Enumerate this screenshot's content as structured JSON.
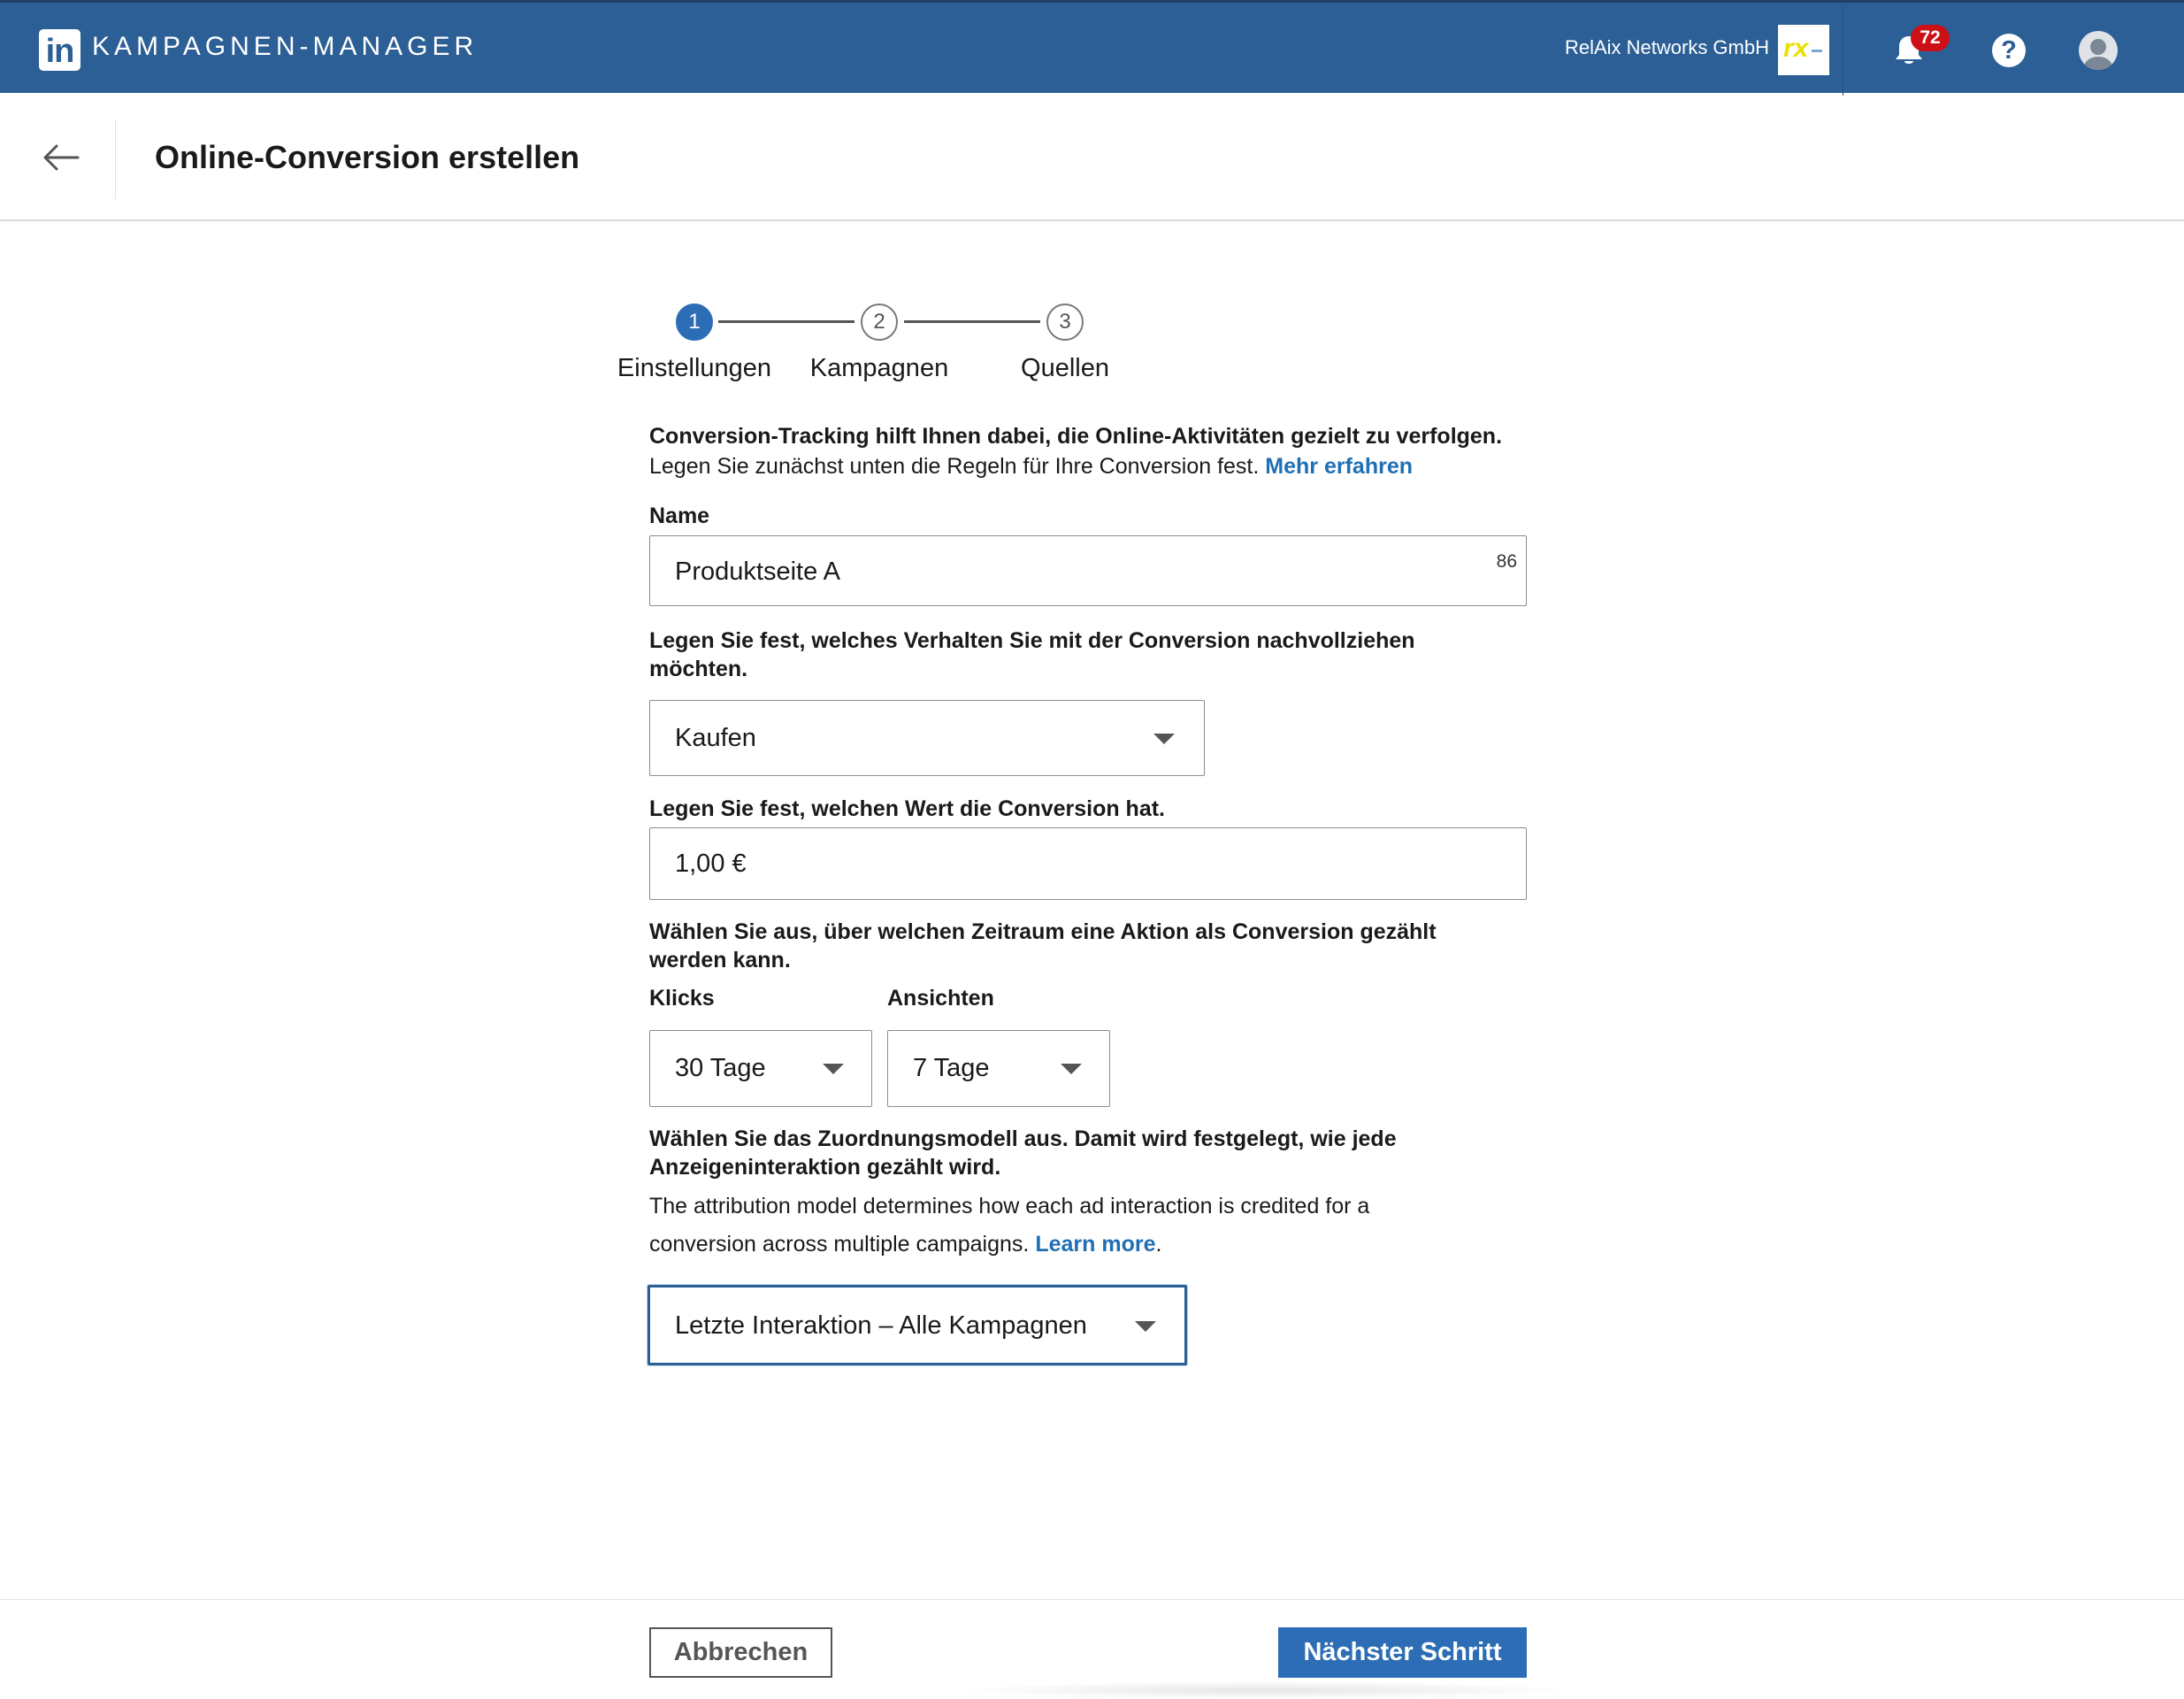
{
  "topbar": {
    "logo_text": "in",
    "app_title": "KAMPAGNEN-MANAGER",
    "company_name": "RelAix Networks GmbH",
    "company_logo_text": "rx",
    "notification_count": "72",
    "help_glyph": "?",
    "bg_color": "#2c5f96"
  },
  "header": {
    "title": "Online-Conversion erstellen"
  },
  "stepper": {
    "steps": [
      {
        "number": "1",
        "label": "Einstellungen",
        "state": "active"
      },
      {
        "number": "2",
        "label": "Kampagnen",
        "state": "todo"
      },
      {
        "number": "3",
        "label": "Quellen",
        "state": "todo"
      }
    ]
  },
  "intro": {
    "bold_line": "Conversion-Tracking hilft Ihnen dabei, die Online-Aktivitäten gezielt zu verfolgen.",
    "line": "Legen Sie zunächst unten die Regeln für Ihre Conversion fest.",
    "link": "Mehr erfahren"
  },
  "form": {
    "name_label": "Name",
    "name_value": "Produktseite A",
    "name_counter": "86",
    "behavior_label": "Legen Sie fest, welches Verhalten Sie mit der Conversion nachvollziehen möchten.",
    "behavior_value": "Kaufen",
    "value_label": "Legen Sie fest, welchen Wert die Conversion hat.",
    "value_value": "1,00 €",
    "window_label": "Wählen Sie aus, über welchen Zeitraum eine Aktion als Conversion gezählt werden kann.",
    "clicks_label": "Klicks",
    "clicks_value": "30 Tage",
    "views_label": "Ansichten",
    "views_value": "7 Tage",
    "attribution_label": "Wählen Sie das Zuordnungsmodell aus. Damit wird festgelegt, wie jede Anzeigeninteraktion gezählt wird.",
    "attribution_help": "The attribution model determines how each ad interaction is credited for a conversion across multiple campaigns.",
    "attribution_link": "Learn more",
    "attribution_period": ".",
    "attribution_value": "Letzte Interaktion – Alle Kampagnen"
  },
  "footer": {
    "cancel_label": "Abbrechen",
    "next_label": "Nächster Schritt"
  },
  "icons": {
    "bell": "bell-icon",
    "help": "help-icon",
    "avatar": "avatar-icon",
    "back": "arrow-left-icon",
    "caret": "caret-down-icon"
  },
  "colors": {
    "primary": "#2c6db5",
    "link": "#1f6fb5",
    "badge": "#cc1016"
  }
}
